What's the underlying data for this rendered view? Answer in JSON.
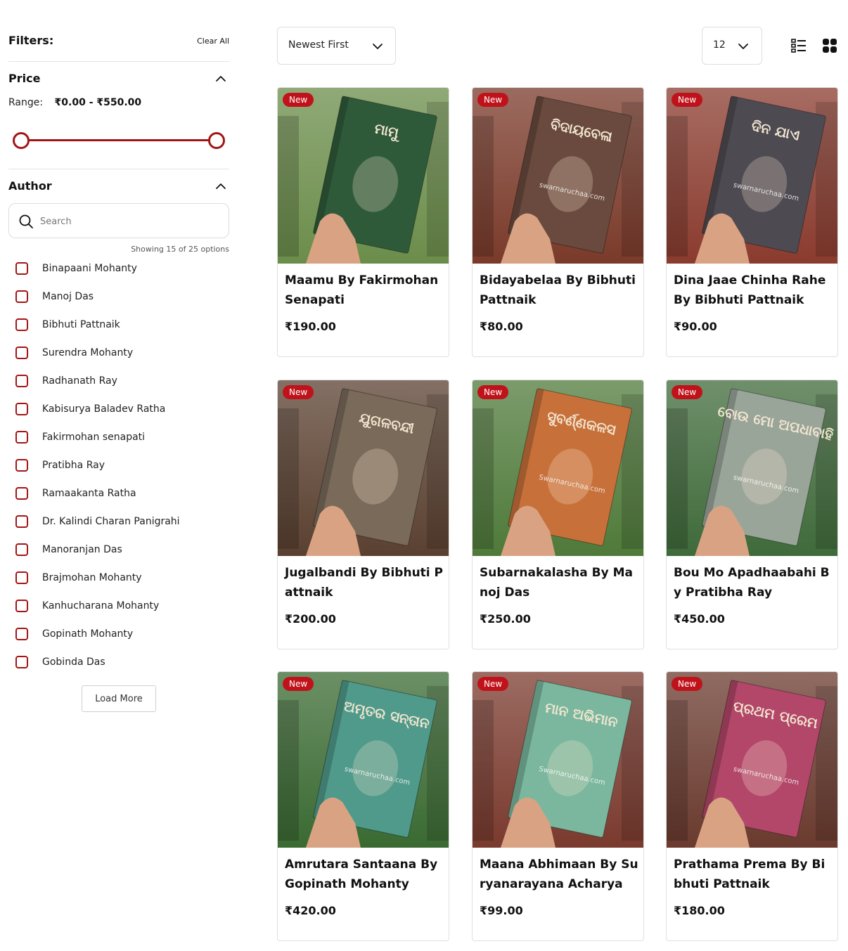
{
  "filters": {
    "title": "Filters:",
    "clear_all": "Clear All"
  },
  "price": {
    "title": "Price",
    "range_label": "Range:",
    "range_value": "₹0.00 - ₹550.00",
    "min_fraction": 0,
    "max_fraction": 1
  },
  "author": {
    "title": "Author",
    "search_placeholder": "Search",
    "showing": "Showing 15 of 25 options",
    "items": [
      {
        "label": "Binapaani Mohanty"
      },
      {
        "label": "Manoj Das"
      },
      {
        "label": "Bibhuti Pattnaik"
      },
      {
        "label": "Surendra Mohanty"
      },
      {
        "label": "Radhanath Ray"
      },
      {
        "label": "Kabisurya Baladev Ratha"
      },
      {
        "label": "Fakirmohan senapati"
      },
      {
        "label": "Pratibha Ray"
      },
      {
        "label": "Ramaakanta Ratha"
      },
      {
        "label": "Dr. Kalindi Charan Panigrahi"
      },
      {
        "label": "Manoranjan Das"
      },
      {
        "label": "Brajmohan Mohanty"
      },
      {
        "label": "Kanhucharana Mohanty"
      },
      {
        "label": "Gopinath Mohanty"
      },
      {
        "label": "Gobinda Das"
      }
    ],
    "load_more": "Load More"
  },
  "toolbar": {
    "sort": "Newest First",
    "per_page": "12"
  },
  "colors": {
    "accent": "#a31515",
    "badge": "#c0121a"
  },
  "products": [
    {
      "badge": "New",
      "title": "Maamu By Fakirmohan Senapati",
      "price": "₹190.00",
      "cover_text": "ମାମୁ",
      "watermark": "",
      "cover": "#2f5a3a",
      "bg": "#6b8d4a"
    },
    {
      "badge": "New",
      "title": "Bidayabelaa By Bibhuti Pattnaik",
      "price": "₹80.00",
      "cover_text": "ବିଦାୟବେଳା",
      "watermark": "swarnaruchaa.com",
      "cover": "#6a4a3e",
      "bg": "#7a3a2a"
    },
    {
      "badge": "New",
      "title": "Dina Jaae Chinha Rahe By Bibhuti Pattnaik",
      "price": "₹90.00",
      "cover_text": "ଦିନ ଯାଏ",
      "watermark": "swarnaruchaa.com",
      "cover": "#4e4a52",
      "bg": "#8a3b2e"
    },
    {
      "badge": "New",
      "title": "Jugalbandi By Bibhuti Pattnaik",
      "price": "₹200.00",
      "cover_text": "ଯୁଗଳବନ୍ଦୀ",
      "watermark": "",
      "cover": "#7a6a5a",
      "bg": "#5a4030"
    },
    {
      "badge": "New",
      "title": "Subarnakalasha By Manoj Das",
      "price": "₹250.00",
      "cover_text": "ସୁବର୍ଣ୍ଣକଳସ",
      "watermark": "Swarnaruchaa.com",
      "cover": "#c7703a",
      "bg": "#4f7a3a"
    },
    {
      "badge": "New",
      "title": "Bou Mo Apadhaabahi By Pratibha Ray",
      "price": "₹450.00",
      "cover_text": "ବୋଉ ମୋ ଅପଧାବାହି",
      "watermark": "swarnaruchaa.com",
      "cover": "#9aa59a",
      "bg": "#3f6a3a"
    },
    {
      "badge": "New",
      "title": "Amrutara Santaana By Gopinath Mohanty",
      "price": "₹420.00",
      "cover_text": "ଅମୃତର ସନ୍ତାନ",
      "watermark": "swarnaruchaa.com",
      "cover": "#4f9a8a",
      "bg": "#3a6a32"
    },
    {
      "badge": "New",
      "title": "Maana Abhimaan By Suryanarayana Acharya",
      "price": "₹99.00",
      "cover_text": "ମାନ ଅଭିମାନ",
      "watermark": "Swarnaruchaa.com",
      "cover": "#7ab79e",
      "bg": "#7a3a2e"
    },
    {
      "badge": "New",
      "title": "Prathama Prema By Bibhuti Pattnaik",
      "price": "₹180.00",
      "cover_text": "ପ୍ରଥମ ପ୍ରେମ",
      "watermark": "swarnaruchaa.com",
      "cover": "#b2476a",
      "bg": "#6a3a2e"
    }
  ]
}
